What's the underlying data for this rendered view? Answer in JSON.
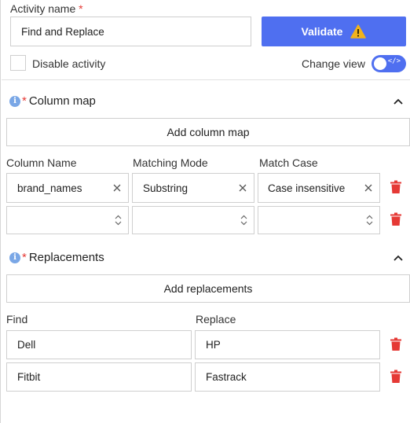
{
  "activity": {
    "label": "Activity name",
    "required_mark": "*",
    "name_value": "Find and Replace",
    "validate_label": "Validate",
    "disable_label": "Disable activity",
    "change_view_label": "Change view"
  },
  "column_map": {
    "title": "Column map",
    "required_mark": "*",
    "add_label": "Add column map",
    "headers": [
      "Column Name",
      "Matching Mode",
      "Match Case"
    ],
    "rows": [
      {
        "column_name": "brand_names",
        "matching_mode": "Substring",
        "match_case": "Case insensitive"
      },
      {
        "column_name": "",
        "matching_mode": "",
        "match_case": ""
      }
    ]
  },
  "replacements": {
    "title": "Replacements",
    "required_mark": "*",
    "add_label": "Add replacements",
    "headers": [
      "Find",
      "Replace"
    ],
    "rows": [
      {
        "find": "Dell",
        "replace": "HP"
      },
      {
        "find": "Fitbit",
        "replace": "Fastrack"
      }
    ]
  },
  "colors": {
    "accent": "#4f6ff0",
    "danger": "#e53935",
    "warning": "#f2b31b",
    "info": "#7aa7e6"
  },
  "icons": {
    "validate": "warning-icon",
    "section": "info-icon",
    "collapse": "chevron-up-icon",
    "delete": "trash-icon",
    "clear": "close-icon",
    "select": "up-down-icon"
  }
}
